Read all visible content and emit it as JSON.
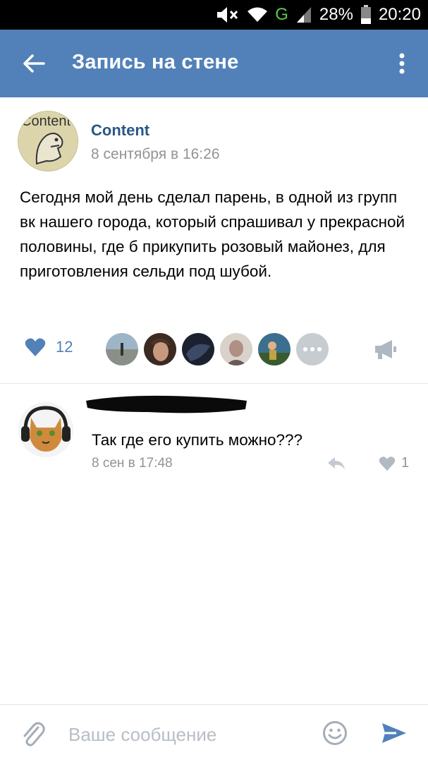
{
  "status_bar": {
    "network": "G",
    "battery": "28%",
    "time": "20:20"
  },
  "header": {
    "title": "Запись на стене"
  },
  "post": {
    "author": "Content",
    "avatar_text": "Content",
    "date": "8 сентября в 16:26",
    "text": "Сегодня мой день сделал парень, в одной из групп вк нашего города, который спрашивал у прекрасной половины, где б прикупить розовый майонез, для приготовления сельди под шубой.",
    "likes_count": "12"
  },
  "comment": {
    "text": "Так где его купить можно???",
    "date": "8 сен в 17:48",
    "likes_count": "1"
  },
  "composer": {
    "placeholder": "Ваше сообщение"
  },
  "colors": {
    "header_bg": "#5181b8",
    "link": "#2a5885",
    "secondary_text": "#939393"
  }
}
